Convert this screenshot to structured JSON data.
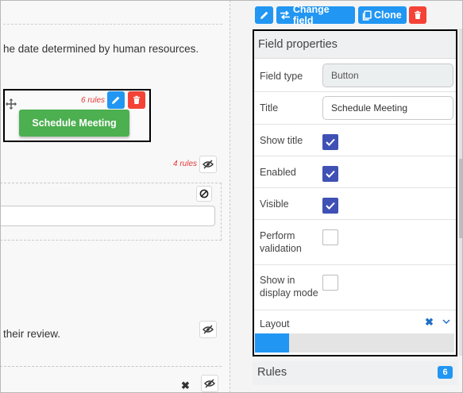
{
  "canvas": {
    "text_top": "he date determined by human resources.",
    "text_bottom": "their review.",
    "selected_field": {
      "rules_label": "6 rules",
      "button_label": "Schedule Meeting"
    },
    "rules_label_2": "4 rules"
  },
  "toolbar": {
    "change_field_label": "Change field",
    "clone_label": "Clone"
  },
  "properties": {
    "header": "Field properties",
    "field_type": {
      "label": "Field type",
      "value": "Button"
    },
    "title": {
      "label": "Title",
      "value": "Schedule Meeting"
    },
    "show_title": {
      "label": "Show title",
      "checked": true
    },
    "enabled": {
      "label": "Enabled",
      "checked": true
    },
    "visible": {
      "label": "Visible",
      "checked": true
    },
    "perform_validation": {
      "label": "Perform validation",
      "checked": false
    },
    "show_in_display_mode": {
      "label": "Show in display mode",
      "checked": false
    },
    "layout": {
      "label": "Layout",
      "progress": 0.17
    }
  },
  "rules": {
    "title": "Rules",
    "count": "6"
  },
  "colors": {
    "accent": "#2196f3",
    "danger": "#f44336",
    "success": "#4caf50",
    "checkbox": "#3f51b5"
  }
}
